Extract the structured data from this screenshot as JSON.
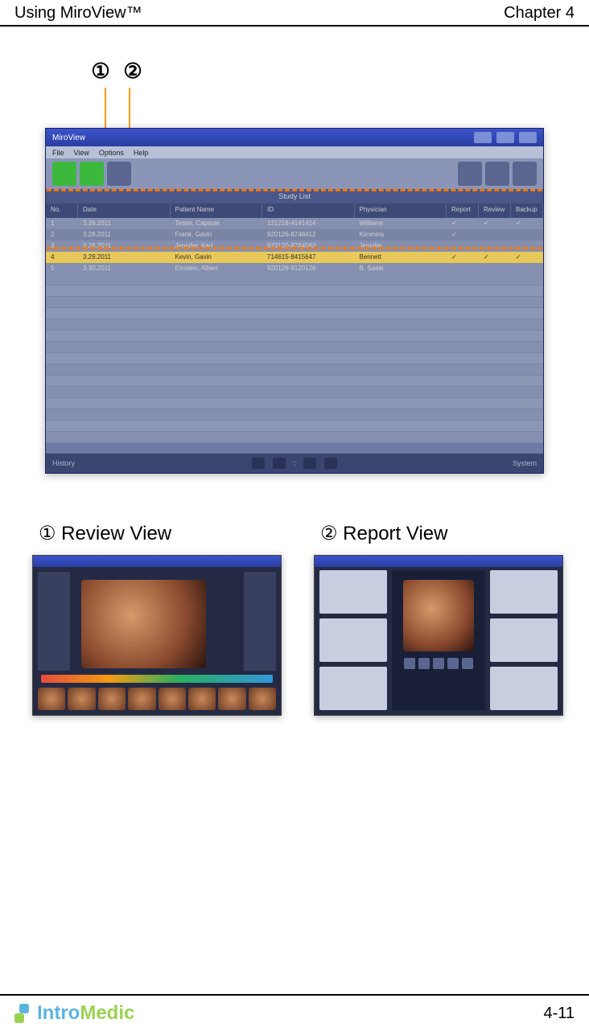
{
  "header": {
    "left": "Using MiroView™",
    "right": "Chapter 4"
  },
  "annotations": {
    "one": "①",
    "two": "②"
  },
  "app": {
    "title_left": "MiroView",
    "menu": [
      "File",
      "View",
      "Options",
      "Help"
    ],
    "sub_header": "Study List",
    "grid_headers": [
      "No.",
      "Date",
      "Patient Name",
      "ID",
      "Physician",
      "Report",
      "Review",
      "Backup"
    ],
    "rows": [
      {
        "cells": [
          "1",
          "3.26.2011",
          "Tester, Capsule",
          "121218-4141414",
          "Williams",
          "✓",
          "✓",
          "✓"
        ]
      },
      {
        "cells": [
          "2",
          "3.28.2011",
          "Frank, Gavin",
          "920126-8748412",
          "Kimmins",
          "✓",
          "",
          ""
        ]
      },
      {
        "cells": [
          "3",
          "3.28.2011",
          "Jennifer, Karl",
          "823120-8784563",
          "Jennifer",
          "",
          "",
          ""
        ]
      },
      {
        "cells": [
          "4",
          "3.29.2011",
          "Kevin, Gavin",
          "714615-8415647",
          "Bennett",
          "✓",
          "✓",
          "✓"
        ],
        "selected": true
      },
      {
        "cells": [
          "5",
          "3.30.2011",
          "Einstein, Albert",
          "920126-9120126",
          "B. Saale",
          "",
          "",
          ""
        ]
      }
    ],
    "status": {
      "pip1": "",
      "colon": ":",
      "pip2": "",
      "left_btn": "History",
      "right_btn": "System"
    }
  },
  "views": {
    "review_label": "① Review View",
    "report_label": "② Report View"
  },
  "footer": {
    "logo_intro": "Intro",
    "logo_medic": "Medic",
    "page_num": "4-11"
  }
}
